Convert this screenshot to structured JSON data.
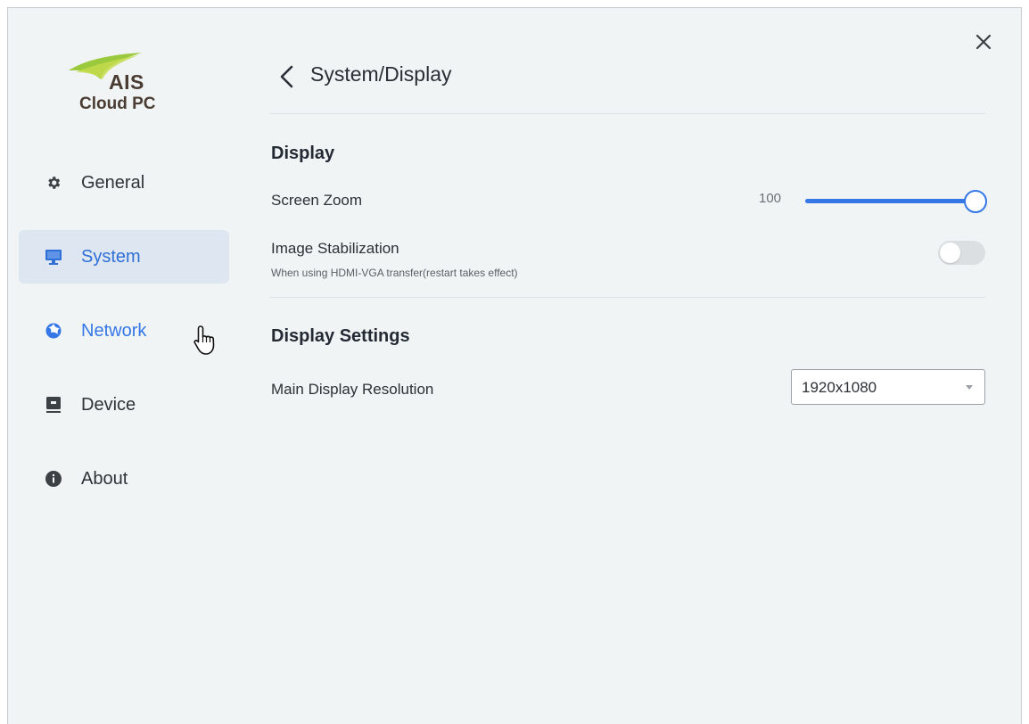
{
  "logo": {
    "brand": "AIS",
    "product": "Cloud PC"
  },
  "sidebar": {
    "items": [
      {
        "label": "General",
        "icon": "gear-icon"
      },
      {
        "label": "System",
        "icon": "monitor-icon",
        "active": true
      },
      {
        "label": "Network",
        "icon": "globe-icon"
      },
      {
        "label": "Device",
        "icon": "device-icon"
      },
      {
        "label": "About",
        "icon": "info-icon"
      }
    ]
  },
  "header": {
    "title": "System/Display"
  },
  "display": {
    "section_title": "Display",
    "screen_zoom": {
      "label": "Screen Zoom",
      "value": "100",
      "fraction": 1.0
    },
    "image_stabilization": {
      "label": "Image Stabilization",
      "description": "When using HDMI-VGA transfer(restart takes effect)",
      "enabled": false
    }
  },
  "display_settings": {
    "section_title": "Display Settings",
    "main_resolution": {
      "label": "Main Display Resolution",
      "selected": "1920x1080"
    }
  },
  "colors": {
    "accent": "#3577e6",
    "active_bg": "#dde6f1",
    "background": "#f0f4f5"
  }
}
